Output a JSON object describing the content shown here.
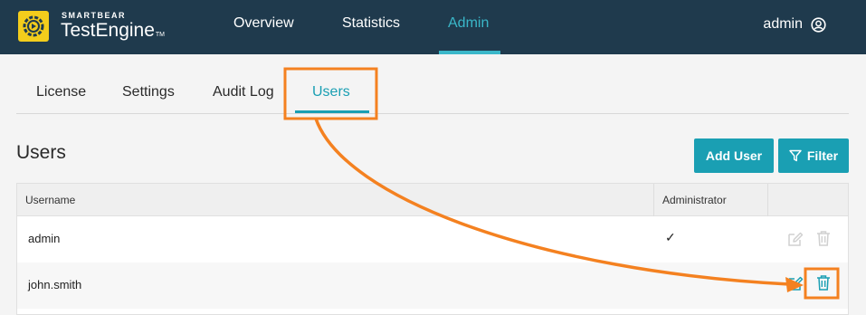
{
  "header": {
    "brand_small": "SMARTBEAR",
    "brand_big": "TestEngine",
    "brand_tm": "TM",
    "nav": [
      {
        "label": "Overview"
      },
      {
        "label": "Statistics"
      },
      {
        "label": "Admin",
        "active": true
      }
    ],
    "user": "admin"
  },
  "tabs": [
    {
      "label": "License"
    },
    {
      "label": "Settings"
    },
    {
      "label": "Audit Log"
    },
    {
      "label": "Users",
      "active": true
    }
  ],
  "page": {
    "title": "Users",
    "add_user_label": "Add User",
    "filter_label": "Filter"
  },
  "table": {
    "columns": [
      "Username",
      "Administrator"
    ],
    "rows": [
      {
        "username": "admin",
        "administrator": "✓",
        "actions_enabled": false
      },
      {
        "username": "john.smith",
        "administrator": "",
        "actions_enabled": true
      }
    ]
  },
  "colors": {
    "header_bg": "#1f3a4d",
    "accent": "#1a9fb3",
    "logo": "#f3cd1c",
    "annotation": "#f48120"
  },
  "icons": [
    "testengine-logo-icon",
    "user-circle-icon",
    "filter-icon",
    "edit-icon",
    "trash-icon",
    "check-icon"
  ]
}
